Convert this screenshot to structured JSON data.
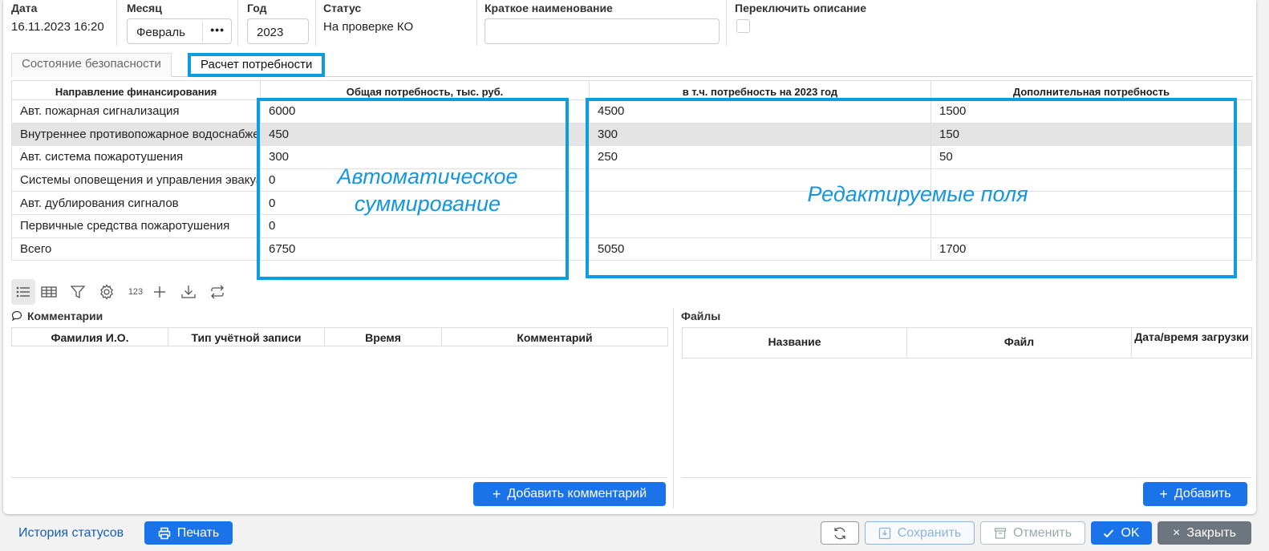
{
  "header": {
    "date": {
      "label": "Дата",
      "value": "16.11.2023 16:20"
    },
    "month": {
      "label": "Месяц",
      "value": "Февраль",
      "more": "•••"
    },
    "year": {
      "label": "Год",
      "value": "2023"
    },
    "status": {
      "label": "Статус",
      "value": "На проверке КО"
    },
    "short_name": {
      "label": "Краткое наименование",
      "value": ""
    },
    "switch_desc": {
      "label": "Переключить описание",
      "checked": false
    }
  },
  "tabs": [
    {
      "label": "Состояние безопасности",
      "active": false
    },
    {
      "label": "Расчет потребности",
      "active": true
    }
  ],
  "needs_table": {
    "columns": [
      "Направление финансирования",
      "Общая потребность, тыс. руб.",
      "в т.ч. потребность на 2023 год",
      "Дополнительная потребность"
    ],
    "rows": [
      [
        "Авт. пожарная сигнализация",
        "6000",
        "4500",
        "1500"
      ],
      [
        "Внутреннее противопожарное водоснабжение",
        "450",
        "300",
        "150"
      ],
      [
        "Авт. система пожаротушения",
        "300",
        "250",
        "50"
      ],
      [
        "Системы оповещения и управления эвакуацией",
        "0",
        "",
        ""
      ],
      [
        "Авт. дублирования сигналов",
        "0",
        "",
        ""
      ],
      [
        "Первичные средства пожаротушения",
        "0",
        "",
        ""
      ],
      [
        "Всего",
        "6750",
        "5050",
        "1700"
      ]
    ]
  },
  "annotations": {
    "auto_sum": "Автоматическое суммирование",
    "editable": "Редактируемые поля",
    "accent": "#0a9ee0"
  },
  "toolbar": {
    "items": [
      "list-icon",
      "table-icon",
      "filter-icon",
      "gear-icon",
      "123",
      "plus-icon",
      "download-icon",
      "repeat-icon"
    ],
    "numeric_label": "123"
  },
  "comments": {
    "title": "Комментарии",
    "columns": [
      "Фамилия И.О.",
      "Тип учётной записи",
      "Время",
      "Комментарий"
    ],
    "add_label": "Добавить комментарий"
  },
  "files": {
    "title": "Файлы",
    "columns": [
      "Название",
      "Файл",
      "Дата/время загрузки"
    ],
    "add_label": "Добавить"
  },
  "footer": {
    "history": "История статусов",
    "print": "Печать",
    "save": "Сохранить",
    "cancel": "Отменить",
    "ok": "OK",
    "close": "Закрыть"
  },
  "colors": {
    "primary": "#1a73e8",
    "accent": "#0a9ee0"
  }
}
